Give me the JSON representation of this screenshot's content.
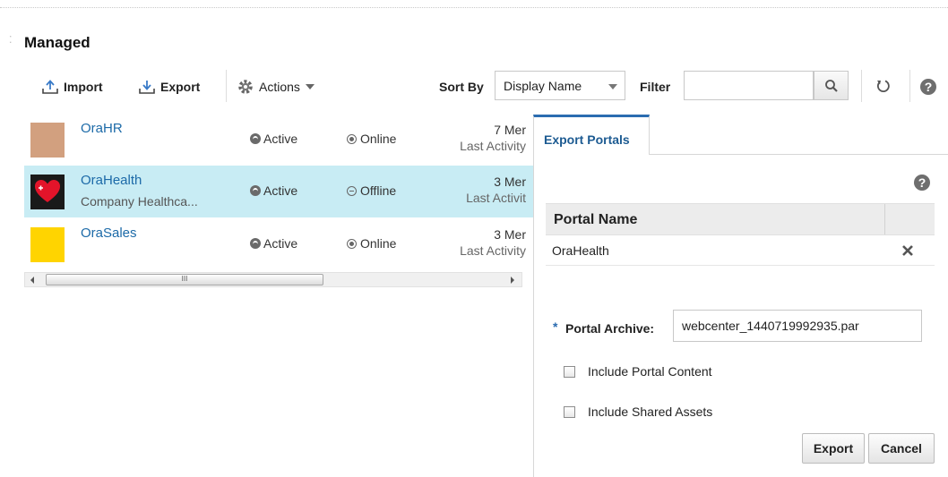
{
  "header": {
    "title": "Managed"
  },
  "toolbar": {
    "import_label": "Import",
    "export_label": "Export",
    "actions_label": "Actions",
    "sort_by_label": "Sort By",
    "sort_value": "Display Name",
    "filter_label": "Filter",
    "filter_value": ""
  },
  "portals": [
    {
      "name": "OraHR",
      "description": "",
      "state": "Active",
      "availability": "Online",
      "members": "7 Mer",
      "activity": "Last Activity",
      "thumb_color": "#d2a07f",
      "selected": false
    },
    {
      "name": "OraHealth",
      "description": "Company Healthca...",
      "state": "Active",
      "availability": "Offline",
      "members": "3 Mer",
      "activity": "Last Activit",
      "thumb_color": "#1a1a1a",
      "selected": true
    },
    {
      "name": "OraSales",
      "description": "",
      "state": "Active",
      "availability": "Online",
      "members": "3 Mer",
      "activity": "Last Activity",
      "thumb_color": "#ffd400",
      "selected": false
    }
  ],
  "scrollbar": {
    "grip": "III"
  },
  "export_panel": {
    "tab_label": "Export Portals",
    "table_header": "Portal Name",
    "rows": [
      {
        "name": "OraHealth"
      }
    ],
    "archive_label": "Portal Archive:",
    "required_marker": "*",
    "archive_value": "webcenter_1440719992935.par",
    "include_content_label": "Include Portal Content",
    "include_assets_label": "Include Shared Assets",
    "export_button": "Export",
    "cancel_button": "Cancel"
  },
  "colors": {
    "accent": "#2b6cb0",
    "link": "#1c6aa8",
    "selected_row": "#c8ecf4"
  },
  "icons": [
    "import-icon",
    "export-icon",
    "gear-icon",
    "search-icon",
    "refresh-icon",
    "help-icon",
    "close-icon",
    "heart-icon"
  ]
}
